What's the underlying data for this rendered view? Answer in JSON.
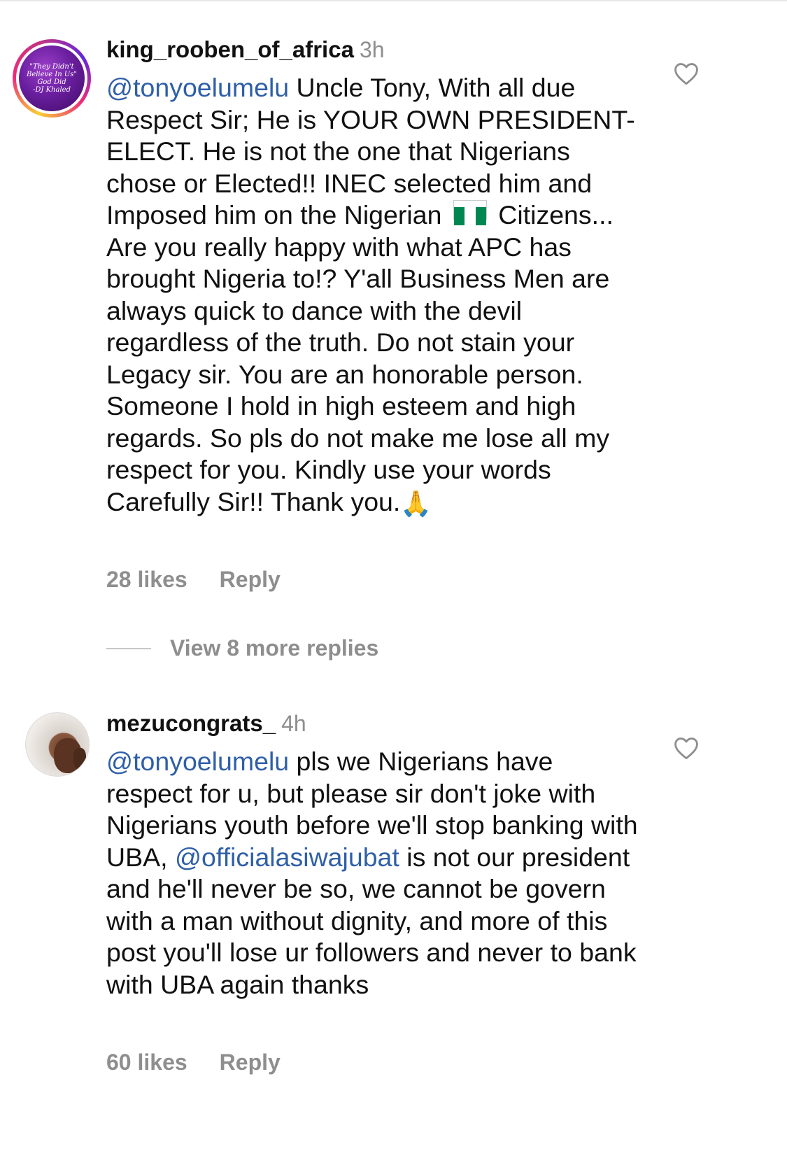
{
  "comments": [
    {
      "username": "king_rooben_of_africa",
      "time": "3h",
      "avatar_text": [
        "\"They Didn't Believe In Us\"",
        "God Did",
        "-DJ Khaled"
      ],
      "mention": "@tonyoelumelu",
      "text_part1": " Uncle Tony, With all due Respect Sir; He is YOUR OWN PRESIDENT-ELECT. He is not the one that Nigerians chose or Elected!! INEC selected him and Imposed him on the Nigerian",
      "flag_emoji": "nigeria-flag",
      "text_part2": " Citizens... Are you really happy with what APC has brought Nigeria to!? Y'all Business Men are always quick to dance with the devil regardless of the truth. Do not stain your Legacy sir. You are an honorable person. Someone I hold in high esteem and high regards. So pls do not make me lose all my respect for you. Kindly use your words Carefully Sir!! Thank you.",
      "end_emoji": "🙏",
      "likes": "28 likes",
      "reply_label": "Reply",
      "view_more": "View 8 more replies"
    },
    {
      "username": "mezucongrats_",
      "time": "4h",
      "mention": "@tonyoelumelu",
      "text_part1": " pls we Nigerians have respect for u, but please sir don't joke with Nigerians youth before we'll stop banking with UBA, ",
      "mention2": "@officialasiwajubat",
      "text_part2": " is not our president and he'll never be so, we cannot be govern with a man without dignity, and more of this post you'll lose ur followers and never to bank with UBA again thanks",
      "likes": "60 likes",
      "reply_label": "Reply"
    }
  ],
  "colors": {
    "mention": "#2f5fa8",
    "muted": "#8e8e8e",
    "flag_green": "#008751"
  }
}
